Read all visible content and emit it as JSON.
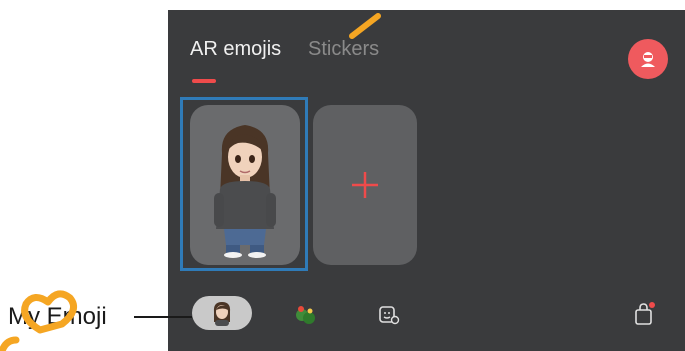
{
  "tabs": [
    {
      "label": "AR emojis",
      "active": true
    },
    {
      "label": "Stickers",
      "active": false
    }
  ],
  "callout": {
    "label": "My Emoji"
  },
  "colors": {
    "background": "#3a3b3d",
    "accent": "#ef4b4b",
    "highlight_frame": "#2f7bb8",
    "annotation": "#f5a623"
  },
  "icons": {
    "profile": "account-emoji-icon",
    "add": "plus-icon",
    "my_emoji": "avatar-thumbnail-icon",
    "sticker": "sticker-icon",
    "camera": "emoji-camera-icon",
    "store": "shopping-bag-icon"
  }
}
